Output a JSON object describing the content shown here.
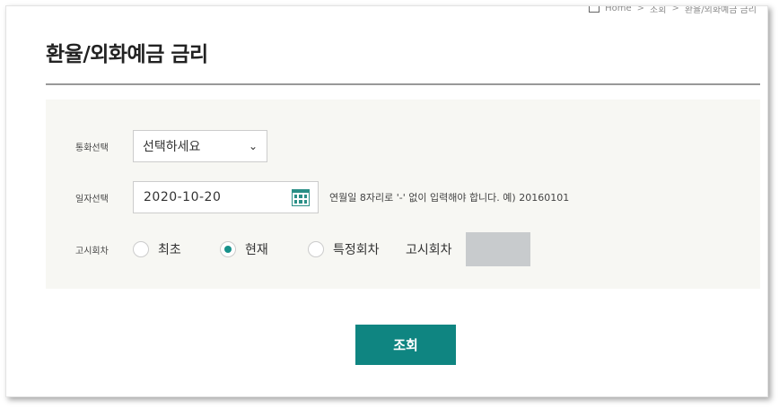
{
  "breadcrumb": [
    "Home",
    "조회",
    "환율/외화예금 금리"
  ],
  "page_title": "환율/외화예금 금리",
  "form": {
    "currency": {
      "label": "통화선택",
      "selected": "선택하세요"
    },
    "date": {
      "label": "일자선택",
      "value": "2020-10-20",
      "hint": "연월일 8자리로 '-' 없이 입력해야 합니다. 예) 20160101"
    },
    "round": {
      "label": "고시회차",
      "options": [
        {
          "label": "최초",
          "checked": false
        },
        {
          "label": "현재",
          "checked": true
        },
        {
          "label": "특정회차",
          "checked": false
        }
      ],
      "specific_label": "고시회차",
      "specific_value": ""
    }
  },
  "query_button": "조회",
  "colors": {
    "accent": "#0f8581",
    "form_bg": "#f7f7f3",
    "disabled_input": "#c8cbcd"
  }
}
